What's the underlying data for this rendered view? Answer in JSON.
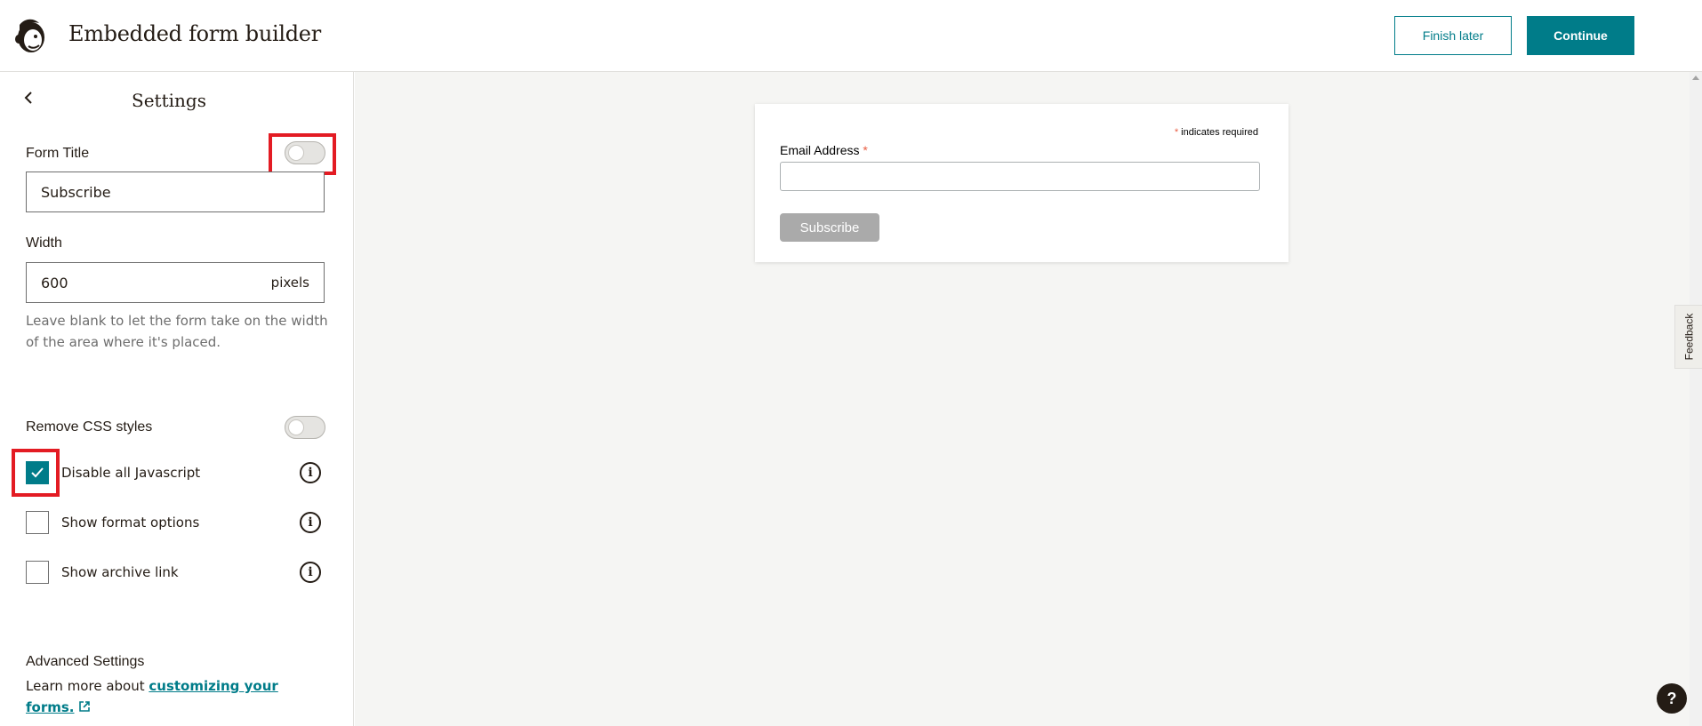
{
  "header": {
    "title": "Embedded form builder",
    "finish_later_label": "Finish later",
    "continue_label": "Continue"
  },
  "sidebar": {
    "title": "Settings",
    "form_title": {
      "label": "Form Title",
      "value": "Subscribe",
      "toggle_on": false
    },
    "width": {
      "label": "Width",
      "value": "600",
      "unit": "pixels",
      "helper": "Leave blank to let the form take on the width of the area where it's placed."
    },
    "remove_css": {
      "label": "Remove CSS styles",
      "toggle_on": false
    },
    "options": [
      {
        "label": "Disable all Javascript",
        "checked": true
      },
      {
        "label": "Show format options",
        "checked": false
      },
      {
        "label": "Show archive link",
        "checked": false
      }
    ],
    "advanced": {
      "title": "Advanced Settings",
      "text_prefix": "Learn more about ",
      "link_text": "customizing your forms."
    }
  },
  "preview": {
    "required_asterisk": "*",
    "required_note": " indicates required",
    "email_label": "Email Address ",
    "email_asterisk": "*",
    "email_value": "",
    "subscribe_label": "Subscribe"
  },
  "feedback_label": "Feedback",
  "help_label": "?",
  "colors": {
    "brand_teal": "#007c89",
    "highlight_red": "#e31b23",
    "required_asterisk": "#e85c41"
  }
}
